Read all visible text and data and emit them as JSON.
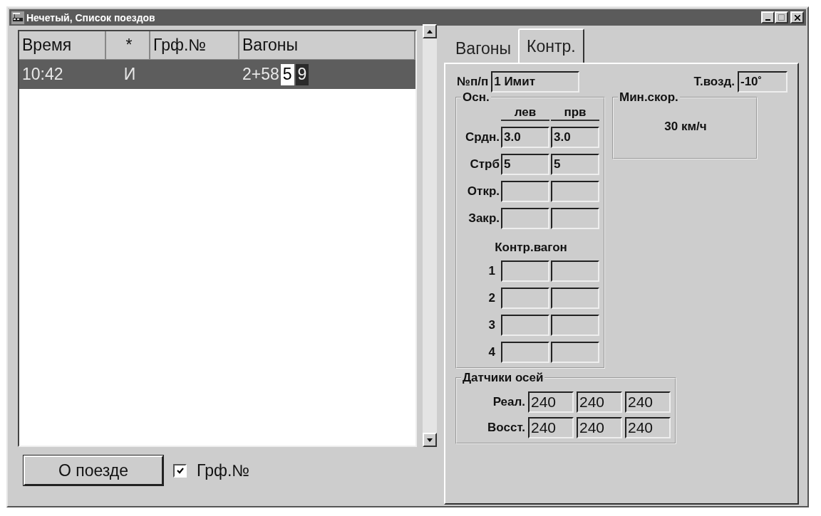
{
  "window": {
    "title": "Нечетый, Список поездов"
  },
  "train_list": {
    "columns": [
      "Время",
      "*",
      "Грф.№",
      "Вагоны"
    ],
    "rows": [
      {
        "time": "10:42",
        "mark": "И",
        "wagons": "2+58",
        "wagon_badges": [
          {
            "text": "5",
            "kind": "light"
          },
          {
            "text": "9",
            "kind": "dark"
          }
        ],
        "selected": true
      }
    ]
  },
  "tabs": [
    {
      "label": "Вагоны",
      "selected": false
    },
    {
      "label": "Контр.",
      "selected": true
    }
  ],
  "control": {
    "number": {
      "label": "№п/п",
      "value": "1 Имит"
    },
    "air_temp": {
      "label": "Т.возд.",
      "value": "-10˚"
    },
    "main_group": {
      "title": "Осн.",
      "column_headers": [
        "лев",
        "прв"
      ],
      "rows": [
        {
          "label": "Срдн.",
          "values": [
            "3.0",
            "3.0"
          ]
        },
        {
          "label": "Стрб",
          "values": [
            "5",
            "5"
          ]
        },
        {
          "label": "Откр."
        },
        {
          "label": "Закр."
        }
      ],
      "wagon_title": "Контр.вагон",
      "wagon_rows": [
        "1",
        "2",
        "3",
        "4"
      ]
    },
    "min_speed": {
      "title": "Мин.скор.",
      "value": "30 км/ч"
    },
    "axle_sensors": {
      "title": "Датчики осей",
      "rows": [
        {
          "label": "Реал.",
          "values": [
            "240",
            "240",
            "240"
          ]
        },
        {
          "label": "Восст.",
          "values": [
            "240",
            "240",
            "240"
          ]
        }
      ]
    }
  },
  "footer": {
    "button": "О поезде",
    "checkbox": {
      "label": "Грф.№",
      "checked": true
    }
  }
}
